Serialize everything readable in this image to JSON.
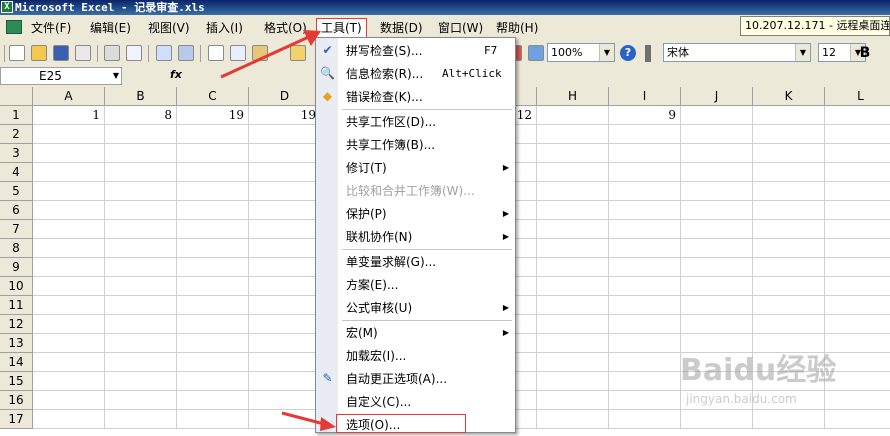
{
  "window": {
    "title": "Microsoft Excel - 记录审查.xls",
    "app_icon_glyph": "X"
  },
  "remote": {
    "text": "10.207.12.171 - 远程桌面连"
  },
  "menubar": {
    "items": [
      {
        "label": "文件(F)"
      },
      {
        "label": "编辑(E)"
      },
      {
        "label": "视图(V)"
      },
      {
        "label": "插入(I)"
      },
      {
        "label": "格式(O)"
      },
      {
        "label": "工具(T)"
      },
      {
        "label": "数据(D)"
      },
      {
        "label": "窗口(W)"
      },
      {
        "label": "帮助(H)"
      }
    ],
    "active_index": 5
  },
  "toolbar": {
    "zoom": "100%",
    "font": "宋体",
    "font_size": "12",
    "bold_label": "B",
    "help_glyph": "?"
  },
  "formula_bar": {
    "name_box": "E25",
    "fx_label": "fx",
    "content": ""
  },
  "grid": {
    "columns": [
      "A",
      "B",
      "C",
      "D",
      "E",
      "F",
      "G",
      "H",
      "I",
      "J",
      "K",
      "L"
    ],
    "rows": [
      "1",
      "2",
      "3",
      "4",
      "5",
      "6",
      "7",
      "8",
      "9",
      "10",
      "11",
      "12",
      "13",
      "14",
      "15",
      "16",
      "17"
    ],
    "row1_values": {
      "A": "1",
      "B": "8",
      "C": "19",
      "D": "19",
      "G": "12",
      "I": "9"
    }
  },
  "tools_menu": {
    "items": [
      {
        "label": "拼写检查(S)...",
        "shortcut": "F7",
        "icon": "spelling-check-icon",
        "glyph": "✔"
      },
      {
        "label": "信息检索(R)...",
        "shortcut": "Alt+Click",
        "icon": "research-icon",
        "glyph": "🔍"
      },
      {
        "label": "错误检查(K)...",
        "icon": "error-check-icon",
        "glyph": "◆"
      },
      {
        "label": "共享工作区(D)..."
      },
      {
        "label": "共享工作簿(B)..."
      },
      {
        "label": "修订(T)",
        "submenu": true
      },
      {
        "label": "比较和合并工作簿(W)...",
        "disabled": true
      },
      {
        "label": "保护(P)",
        "submenu": true
      },
      {
        "label": "联机协作(N)",
        "submenu": true
      },
      {
        "label": "单变量求解(G)..."
      },
      {
        "label": "方案(E)..."
      },
      {
        "label": "公式审核(U)",
        "submenu": true
      },
      {
        "label": "宏(M)",
        "submenu": true
      },
      {
        "label": "加载宏(I)..."
      },
      {
        "label": "自动更正选项(A)...",
        "icon": "autocorrect-icon",
        "glyph": "✎"
      },
      {
        "label": "自定义(C)..."
      },
      {
        "label": "选项(O)..."
      }
    ],
    "submenu_glyph": "▶",
    "highlighted_index": 16
  },
  "watermark": {
    "main": "Baidu经验",
    "sub": "jingyan.baidu.com"
  },
  "colors": {
    "annotation_red": "#e53935",
    "titlebar_blue": "#0a246a"
  }
}
